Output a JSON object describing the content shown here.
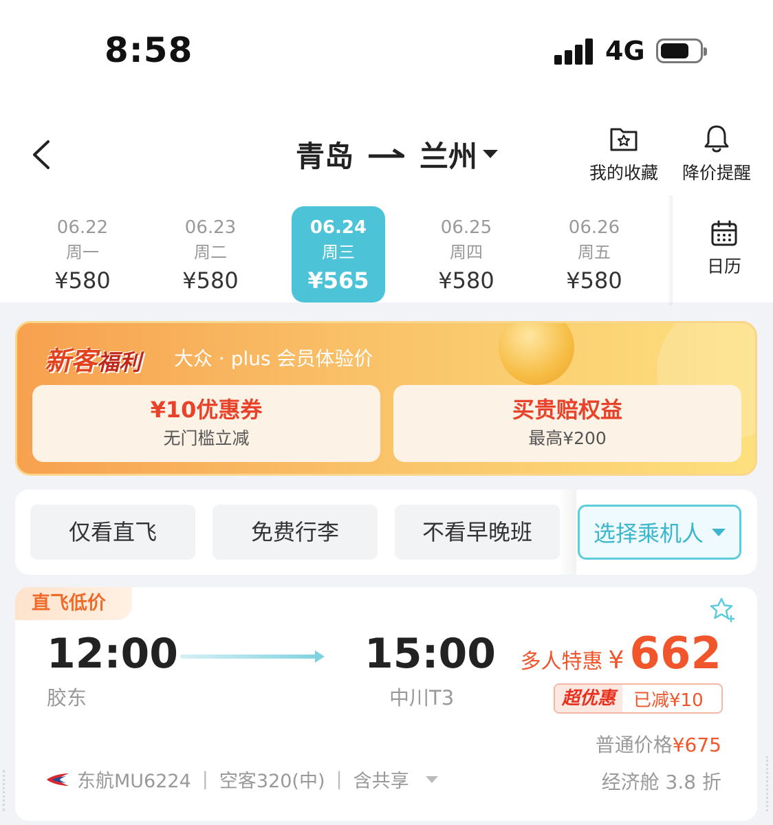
{
  "status_bar": {
    "time": "8:58",
    "network": "4G"
  },
  "header": {
    "origin": "青岛",
    "destination": "兰州",
    "favorites_label": "我的收藏",
    "price_alert_label": "降价提醒"
  },
  "dates": [
    {
      "date": "06.22",
      "weekday": "周一",
      "price": "¥580"
    },
    {
      "date": "06.23",
      "weekday": "周二",
      "price": "¥580"
    },
    {
      "date": "06.24",
      "weekday": "周三",
      "price": "¥565"
    },
    {
      "date": "06.25",
      "weekday": "周四",
      "price": "¥580"
    },
    {
      "date": "06.26",
      "weekday": "周五",
      "price": "¥580"
    }
  ],
  "calendar_label": "日历",
  "promo": {
    "title_1": "新客",
    "title_2": "福利",
    "subtitle": "大众 · plus 会员体验价",
    "card_1_title": "¥10优惠券",
    "card_1_sub": "无门槛立减",
    "card_2_title": "买贵赔权益",
    "card_2_sub": "最高¥200"
  },
  "filters": {
    "direct_only": "仅看直飞",
    "free_baggage": "免费行李",
    "no_early_late": "不看早晚班",
    "select_passenger": "选择乘机人"
  },
  "flight": {
    "tag": "直飞低价",
    "depart_time": "12:00",
    "depart_airport": "胶东",
    "arrive_time": "15:00",
    "arrive_airport": "中川T3",
    "price_prefix": "多人特惠",
    "price_currency": "¥",
    "price": "662",
    "discount_badge": "超优惠",
    "discount_text": "已减¥10",
    "normal_price_label": "普通价格",
    "normal_price": "¥675",
    "cabin": "经济舱 3.8 折",
    "airline": "东航MU6224",
    "aircraft": "空客320(中)",
    "share": "含共享"
  },
  "colors": {
    "accent": "#4cc3d6",
    "price_red": "#f0552b"
  }
}
